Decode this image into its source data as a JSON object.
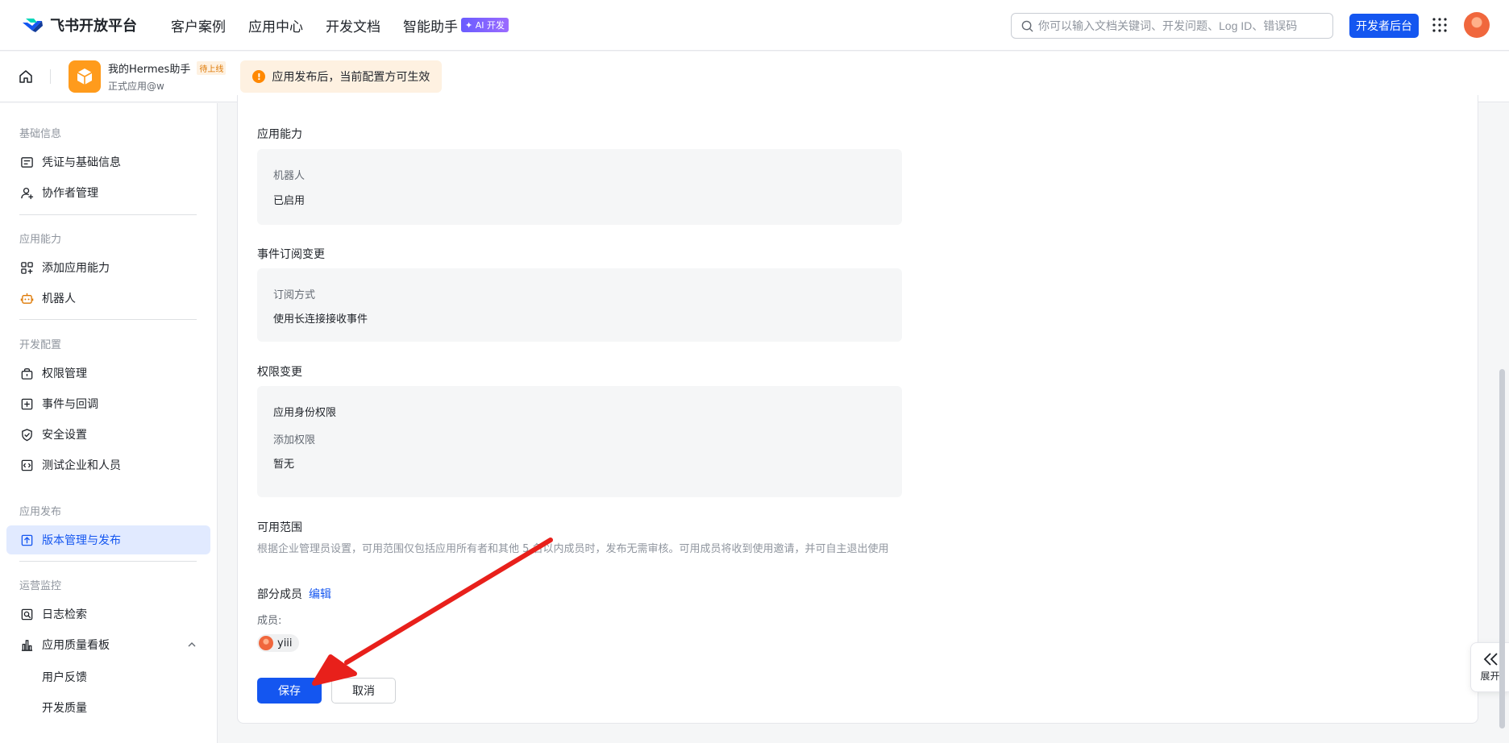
{
  "header": {
    "brand": "飞书开放平台",
    "nav": [
      {
        "label": "客户案例"
      },
      {
        "label": "应用中心"
      },
      {
        "label": "开发文档"
      },
      {
        "label": "智能助手",
        "badge": "AI 开发"
      }
    ],
    "search_placeholder": "你可以输入文档关键词、开发问题、Log ID、错误码",
    "dev_console": "开发者后台"
  },
  "subheader": {
    "app_name": "我的Hermes助手",
    "app_status": "待上线",
    "app_type": "正式应用@w",
    "notice": "应用发布后，当前配置方可生效"
  },
  "sidebar": {
    "sections": [
      {
        "title": "基础信息",
        "items": [
          {
            "label": "凭证与基础信息",
            "icon": "id-card-icon"
          },
          {
            "label": "协作者管理",
            "icon": "user-add-icon"
          }
        ]
      },
      {
        "title": "应用能力",
        "items": [
          {
            "label": "添加应用能力",
            "icon": "apps-add-icon"
          },
          {
            "label": "机器人",
            "icon": "robot-icon"
          }
        ]
      },
      {
        "title": "开发配置",
        "items": [
          {
            "label": "权限管理",
            "icon": "lock-box-icon"
          },
          {
            "label": "事件与回调",
            "icon": "event-icon"
          },
          {
            "label": "安全设置",
            "icon": "shield-icon"
          },
          {
            "label": "测试企业和人员",
            "icon": "code-icon"
          }
        ]
      },
      {
        "title": "应用发布",
        "items": [
          {
            "label": "版本管理与发布",
            "icon": "upload-icon",
            "active": true
          }
        ]
      },
      {
        "title": "运营监控",
        "items": [
          {
            "label": "日志检索",
            "icon": "log-search-icon"
          },
          {
            "label": "应用质量看板",
            "icon": "bar-chart-icon",
            "sub": [
              "用户反馈",
              "开发质量"
            ]
          }
        ]
      }
    ]
  },
  "main": {
    "capability": {
      "title": "应用能力",
      "label": "机器人",
      "value": "已启用"
    },
    "events": {
      "title": "事件订阅变更",
      "label": "订阅方式",
      "value": "使用长连接接收事件"
    },
    "permissions": {
      "title": "权限变更",
      "heading": "应用身份权限",
      "label": "添加权限",
      "value": "暂无"
    },
    "scope": {
      "title": "可用范围",
      "description": "根据企业管理员设置，可用范围仅包括应用所有者和其他 5 名以内成员时，发布无需审核。可用成员将收到使用邀请，并可自主退出使用",
      "mode": "部分成员",
      "edit": "编辑",
      "members_label": "成员:",
      "members": [
        "yiii"
      ]
    },
    "save": "保存",
    "cancel": "取消"
  },
  "expand_panel": {
    "label": "展开"
  },
  "colors": {
    "primary": "#1456f0",
    "warning": "#ff8800",
    "annotation_arrow": "#e8201b"
  }
}
